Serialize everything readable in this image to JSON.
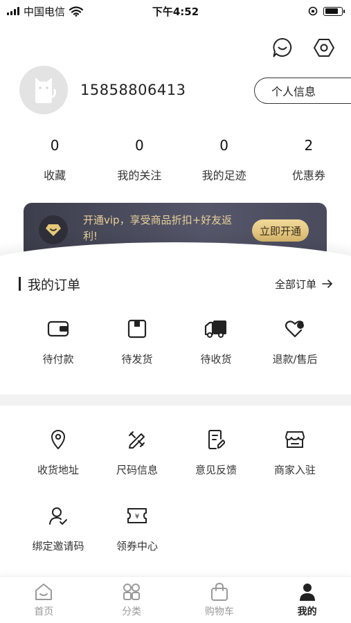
{
  "status_bar": {
    "carrier": "中国电信",
    "time": "下午4:52",
    "battery_level": 0.8
  },
  "header": {
    "icons": [
      "message-icon",
      "settings-hexagon-icon"
    ]
  },
  "profile": {
    "phone": "15858806413",
    "info_button": "个人信息"
  },
  "stats": [
    {
      "value": "0",
      "label": "收藏"
    },
    {
      "value": "0",
      "label": "我的关注"
    },
    {
      "value": "0",
      "label": "我的足迹"
    },
    {
      "value": "2",
      "label": "优惠券"
    }
  ],
  "vip": {
    "text": "开通vip，享受商品折扣+好友返利!",
    "button": "立即开通",
    "accent": "#e8d19a"
  },
  "orders": {
    "title": "我的订单",
    "all_label": "全部订单",
    "items": [
      {
        "label": "待付款",
        "icon": "wallet-icon"
      },
      {
        "label": "待发货",
        "icon": "package-icon"
      },
      {
        "label": "待收货",
        "icon": "truck-icon"
      },
      {
        "label": "退款/售后",
        "icon": "heart-refund-icon"
      }
    ]
  },
  "services": {
    "row1": [
      {
        "label": "收货地址",
        "icon": "location-pin-icon"
      },
      {
        "label": "尺码信息",
        "icon": "ruler-pencil-icon"
      },
      {
        "label": "意见反馈",
        "icon": "feedback-note-icon"
      },
      {
        "label": "商家入驻",
        "icon": "store-icon"
      }
    ],
    "row2": [
      {
        "label": "绑定邀请码",
        "icon": "user-check-icon"
      },
      {
        "label": "领券中心",
        "icon": "coupon-ticket-icon"
      }
    ]
  },
  "tabbar": [
    {
      "label": "首页",
      "icon": "home-icon",
      "active": false
    },
    {
      "label": "分类",
      "icon": "grid-icon",
      "active": false
    },
    {
      "label": "购物车",
      "icon": "bag-icon",
      "active": false
    },
    {
      "label": "我的",
      "icon": "person-icon",
      "active": true
    }
  ]
}
